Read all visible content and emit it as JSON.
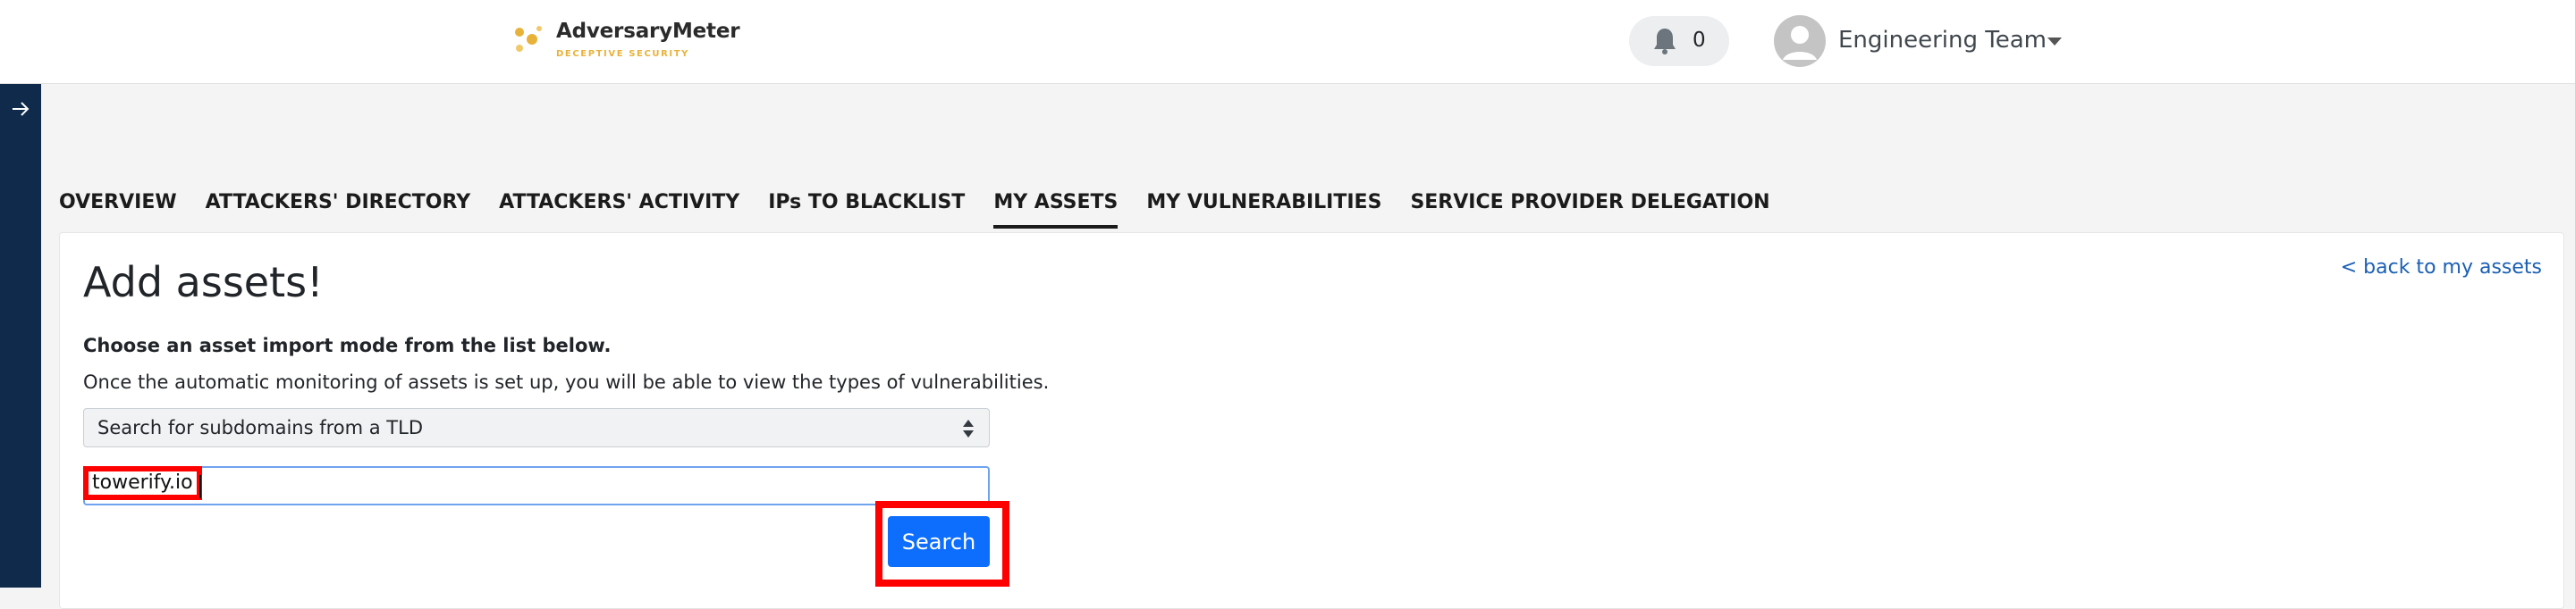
{
  "brand": {
    "name": "AdversaryMeter",
    "tagline": "DECEPTIVE SECURITY",
    "accent": "#e8b23a"
  },
  "header": {
    "notification_count": "0",
    "user_name": "Engineering Team"
  },
  "tabs": [
    {
      "label": "OVERVIEW",
      "active": false
    },
    {
      "label": "ATTACKERS' DIRECTORY",
      "active": false
    },
    {
      "label": "ATTACKERS' ACTIVITY",
      "active": false
    },
    {
      "label": "IPs TO BLACKLIST",
      "active": false
    },
    {
      "label": "MY ASSETS",
      "active": true
    },
    {
      "label": "MY VULNERABILITIES",
      "active": false
    },
    {
      "label": "SERVICE PROVIDER DELEGATION",
      "active": false
    }
  ],
  "main": {
    "title": "Add assets!",
    "back_link": "< back to my assets",
    "instruction": "Choose an asset import mode from the list below.",
    "info": "Once the automatic monitoring of assets is set up, you will be able to view the types of vulnerabilities.",
    "mode_select": {
      "selected": "Search for subdomains from a TLD"
    },
    "domain_input": {
      "value": "towerify.io"
    },
    "search_label": "Search"
  },
  "colors": {
    "sidebar": "#0f2a4a",
    "primary_button": "#0d6efd",
    "highlight": "#ff0000"
  }
}
